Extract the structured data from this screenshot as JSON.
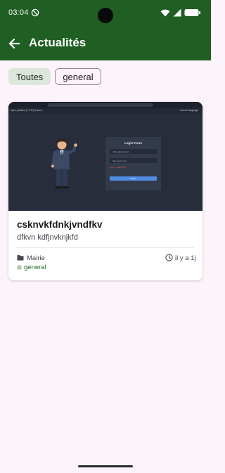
{
  "status_bar": {
    "time": "03:04",
    "icons": [
      "do-not-disturb-icon",
      "wifi-icon",
      "signal-icon",
      "battery-icon"
    ]
  },
  "app_bar": {
    "title": "Actualités",
    "back_icon": "arrow-left-icon",
    "background": "#1f5f23"
  },
  "filters": {
    "chips": [
      {
        "label": "Toutes",
        "selected": true
      },
      {
        "label": "general",
        "selected": false
      }
    ]
  },
  "news": {
    "items": [
      {
        "title": "csknvkfdnkjvndfkv",
        "description": "dfkvn kdfjnvknjkfd",
        "author": "Mairie",
        "time_ago": "il y a 1j",
        "category": "general",
        "image": {
          "form_title": "Login Form",
          "menu_text": "open youtube  [?+UP] reason",
          "menu_right": "secure language",
          "email_text": "ndlovu@mail.com",
          "password_text": "http://secret.tld",
          "error_text": "Error: invalid PIN",
          "button_text": "Log In"
        }
      }
    ]
  },
  "colors": {
    "primary": "#1f5f23",
    "background": "#fdf4fb",
    "chip_selected": "#dde6da",
    "category_text": "#1f6a2a"
  }
}
